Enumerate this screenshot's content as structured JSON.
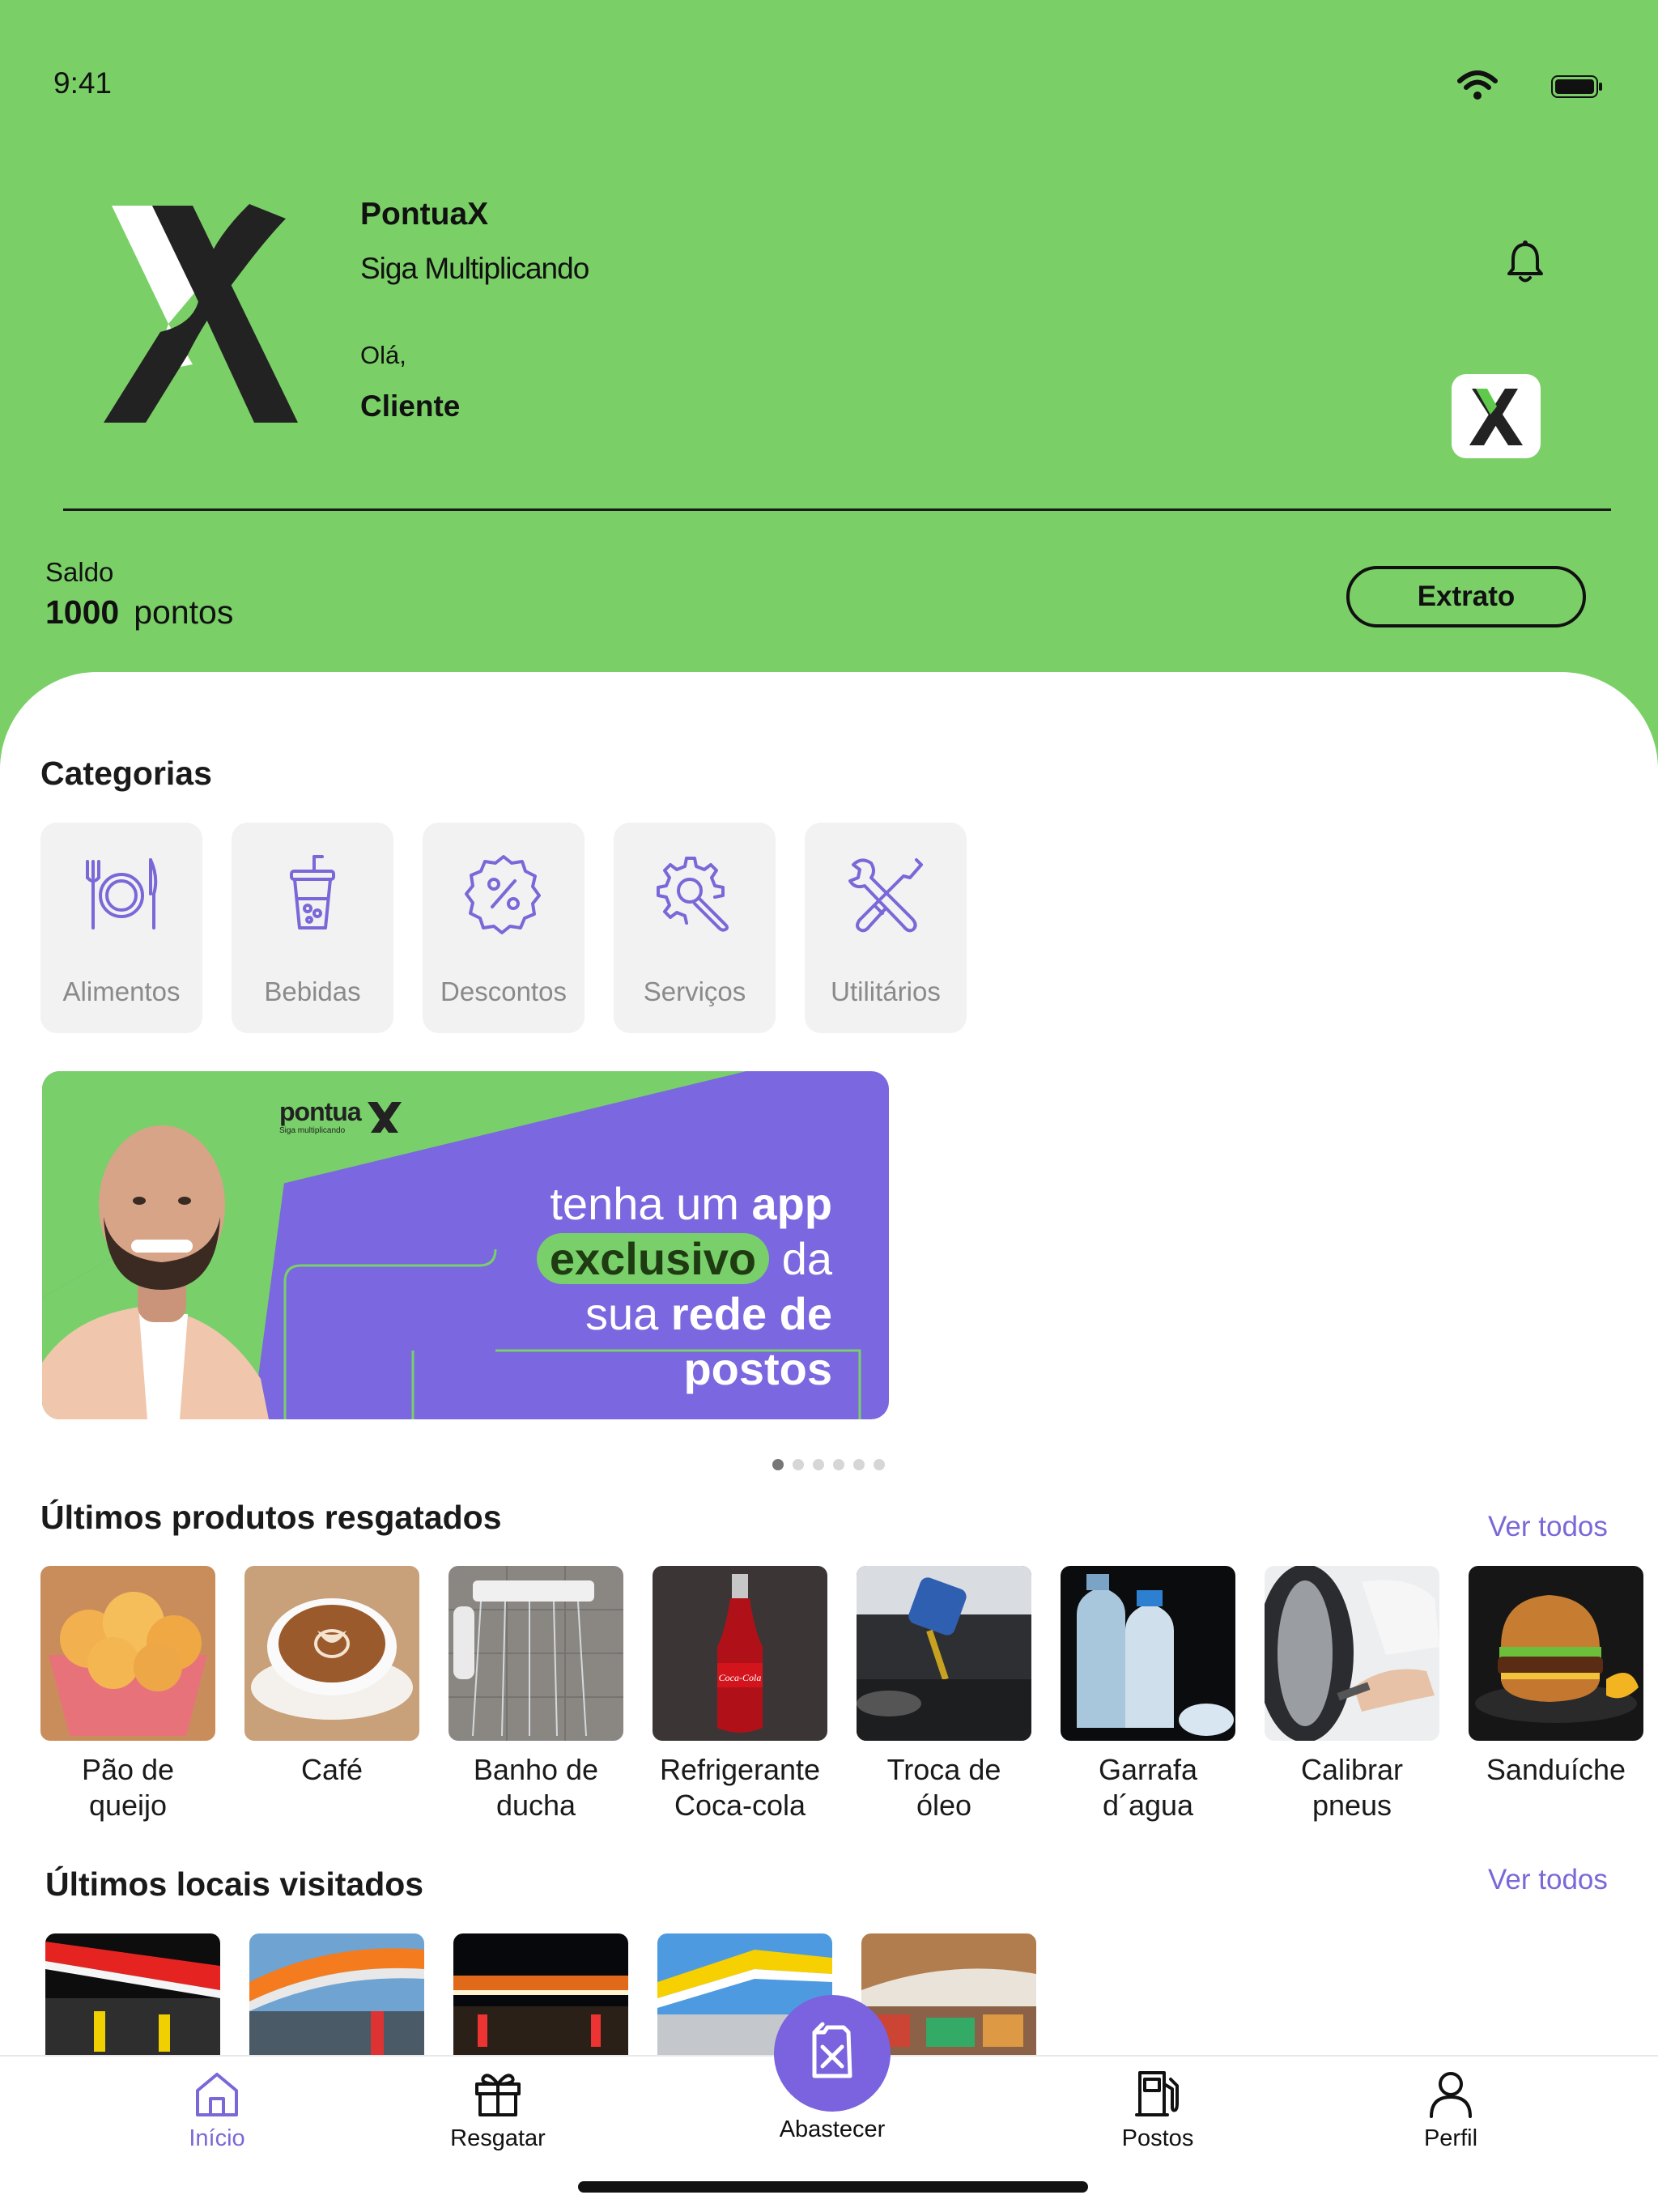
{
  "status_bar": {
    "time": "9:41"
  },
  "header": {
    "app_name": "PontuaX",
    "tagline": "Siga Multiplicando",
    "greeting": "Olá,",
    "user_name": "Cliente"
  },
  "balance": {
    "label": "Saldo",
    "value": "1000",
    "unit": "pontos",
    "statement_button": "Extrato"
  },
  "categories": {
    "title": "Categorias",
    "items": [
      {
        "label": "Alimentos",
        "icon": "plate-cutlery-icon"
      },
      {
        "label": "Bebidas",
        "icon": "drink-cup-icon"
      },
      {
        "label": "Descontos",
        "icon": "discount-badge-icon"
      },
      {
        "label": "Serviços",
        "icon": "gear-wrench-icon"
      },
      {
        "label": "Utilitários",
        "icon": "wrench-screwdriver-icon"
      }
    ]
  },
  "banner": {
    "brand": "pontua",
    "brand_sub": "Siga multiplicando",
    "line1_light": "tenha um",
    "line1_bold": "app",
    "line2_highlight": "exclusivo",
    "line2_light": "da",
    "line3_light": "sua",
    "line3_bold": "rede de",
    "line4_bold": "postos",
    "slide_index": 1,
    "slide_count": 6
  },
  "products": {
    "title": "Últimos produtos resgatados",
    "see_all": "Ver todos",
    "items": [
      {
        "line1": "Pão de",
        "line2": "queijo"
      },
      {
        "line1": "Café",
        "line2": ""
      },
      {
        "line1": "Banho de",
        "line2": "ducha"
      },
      {
        "line1": "Refrigerante",
        "line2": "Coca-cola"
      },
      {
        "line1": "Troca de",
        "line2": "óleo"
      },
      {
        "line1": "Garrafa",
        "line2": "d´agua"
      },
      {
        "line1": "Calibrar",
        "line2": "pneus"
      },
      {
        "line1": "Sanduíche",
        "line2": ""
      }
    ]
  },
  "places": {
    "title": "Últimos locais visitados",
    "see_all": "Ver todos"
  },
  "tabbar": {
    "items": [
      {
        "label": "Início",
        "icon": "home-icon",
        "active": true
      },
      {
        "label": "Resgatar",
        "icon": "gift-icon",
        "active": false
      },
      {
        "label": "Abastecer",
        "icon": "fuel-can-icon",
        "active": false
      },
      {
        "label": "Postos",
        "icon": "fuel-pump-icon",
        "active": false
      },
      {
        "label": "Perfil",
        "icon": "user-icon",
        "active": false
      }
    ]
  },
  "colors": {
    "header_green": "#7ad067",
    "accent_purple": "#7b62de",
    "link_purple": "#7a68d8"
  }
}
